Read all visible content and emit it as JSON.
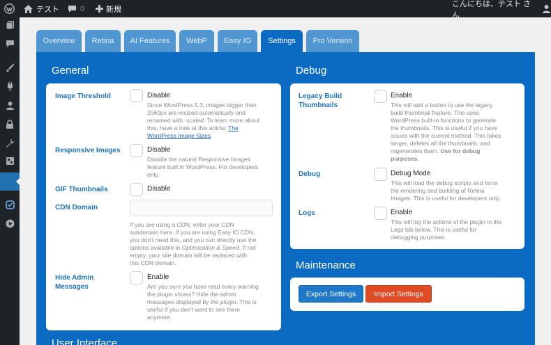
{
  "admin_bar": {
    "site_name": "テスト",
    "comments_count": "0",
    "new_label": "新規",
    "greeting": "こんにちは、テスト さん"
  },
  "tabs": [
    {
      "label": "Overview",
      "active": false
    },
    {
      "label": "Retina",
      "active": false
    },
    {
      "label": "AI Features",
      "active": false
    },
    {
      "label": "WebP",
      "active": false
    },
    {
      "label": "Easy IO",
      "active": false
    },
    {
      "label": "Settings",
      "active": true
    },
    {
      "label": "Pro Version",
      "active": false
    }
  ],
  "general": {
    "title": "General",
    "image_threshold": {
      "label": "Image Threshold",
      "option": "Disable",
      "desc_lines": [
        "Since WordPress 5.3, images bigger than",
        "2560px are resized automatically and"
      ],
      "desc_line3_pre": "renamed with ",
      "desc_line3_em": "-scaled",
      "desc_line3_post": ". To learn more about",
      "desc_line4_pre": "this, have a look at this article: ",
      "desc_line4_link": "The",
      "desc_line5_link": "WordPress Image Sizes",
      "desc_line5_post": "."
    },
    "responsive_images": {
      "label": "Responsive Images",
      "option": "Disable",
      "desc_lines": [
        "Disable the natural Responsive Images",
        "feature built in WordPress. For developers",
        "only."
      ]
    },
    "gif_thumbnails": {
      "label": "GIF Thumbnails",
      "option": "Disable"
    },
    "cdn_domain": {
      "label": "CDN Domain",
      "value": "",
      "desc_lines": [
        "If you are using a CDN, enter your CDN",
        "subdomain here. If you are using Easy IO CDN,",
        "you don't need this, and you can directly use the"
      ],
      "desc_line4_pre": "options available in ",
      "desc_line4_em": "Optimization & Speed",
      "desc_line4_post": ". If not",
      "desc_lines_end": [
        "empty, your site domain will be replaced with",
        "this CDN domain."
      ]
    },
    "hide_admin_messages": {
      "label_line1": "Hide Admin",
      "label_line2": "Messages",
      "option": "Enable",
      "desc_lines": [
        "Are you sure you have read every warning",
        "the plugin shows? Hide the admin",
        "messages displayed by the plugin. This is",
        "useful if you don't want to see them",
        "anymore."
      ]
    }
  },
  "debug": {
    "title": "Debug",
    "legacy_build": {
      "label_line1": "Legacy Build",
      "label_line2": "Thumbnails",
      "option": "Enable",
      "desc_lines": [
        "This will add a button to use the legacy",
        "build thumbnail feature. This uses",
        "WordPress built-in functions to generate",
        "the thumbnails. This is useful if you have",
        "issues with the current method. This takes",
        "longer, deletes all the thumbnails, and"
      ],
      "desc_line7_pre": "regenerates them. ",
      "desc_line7_bold": "Use for debug",
      "desc_line8_bold": "purposes."
    },
    "debug_mode": {
      "label": "Debug",
      "option": "Debug Mode",
      "desc_lines": [
        "This will load the debug scripts and force",
        "the rendering and building of Retina",
        "Images. This is useful for developers only."
      ]
    },
    "logs": {
      "label": "Logs",
      "option": "Enable",
      "desc_lines": [
        "This will log the actions of the plugin in the",
        "Logs tab below. This is useful for",
        "debugging purposes."
      ]
    }
  },
  "maintenance": {
    "title": "Maintenance",
    "export_label": "Export Settings",
    "import_label": "Import Settings"
  },
  "user_interface": {
    "title": "User Interface"
  },
  "colors": {
    "admin_bar": "#1d2327",
    "panel": "#0b6ac2",
    "tab": "#4f96d3",
    "export_button": "#1f78c8",
    "import_button": "#e04a24",
    "label": "#1f73b8"
  }
}
